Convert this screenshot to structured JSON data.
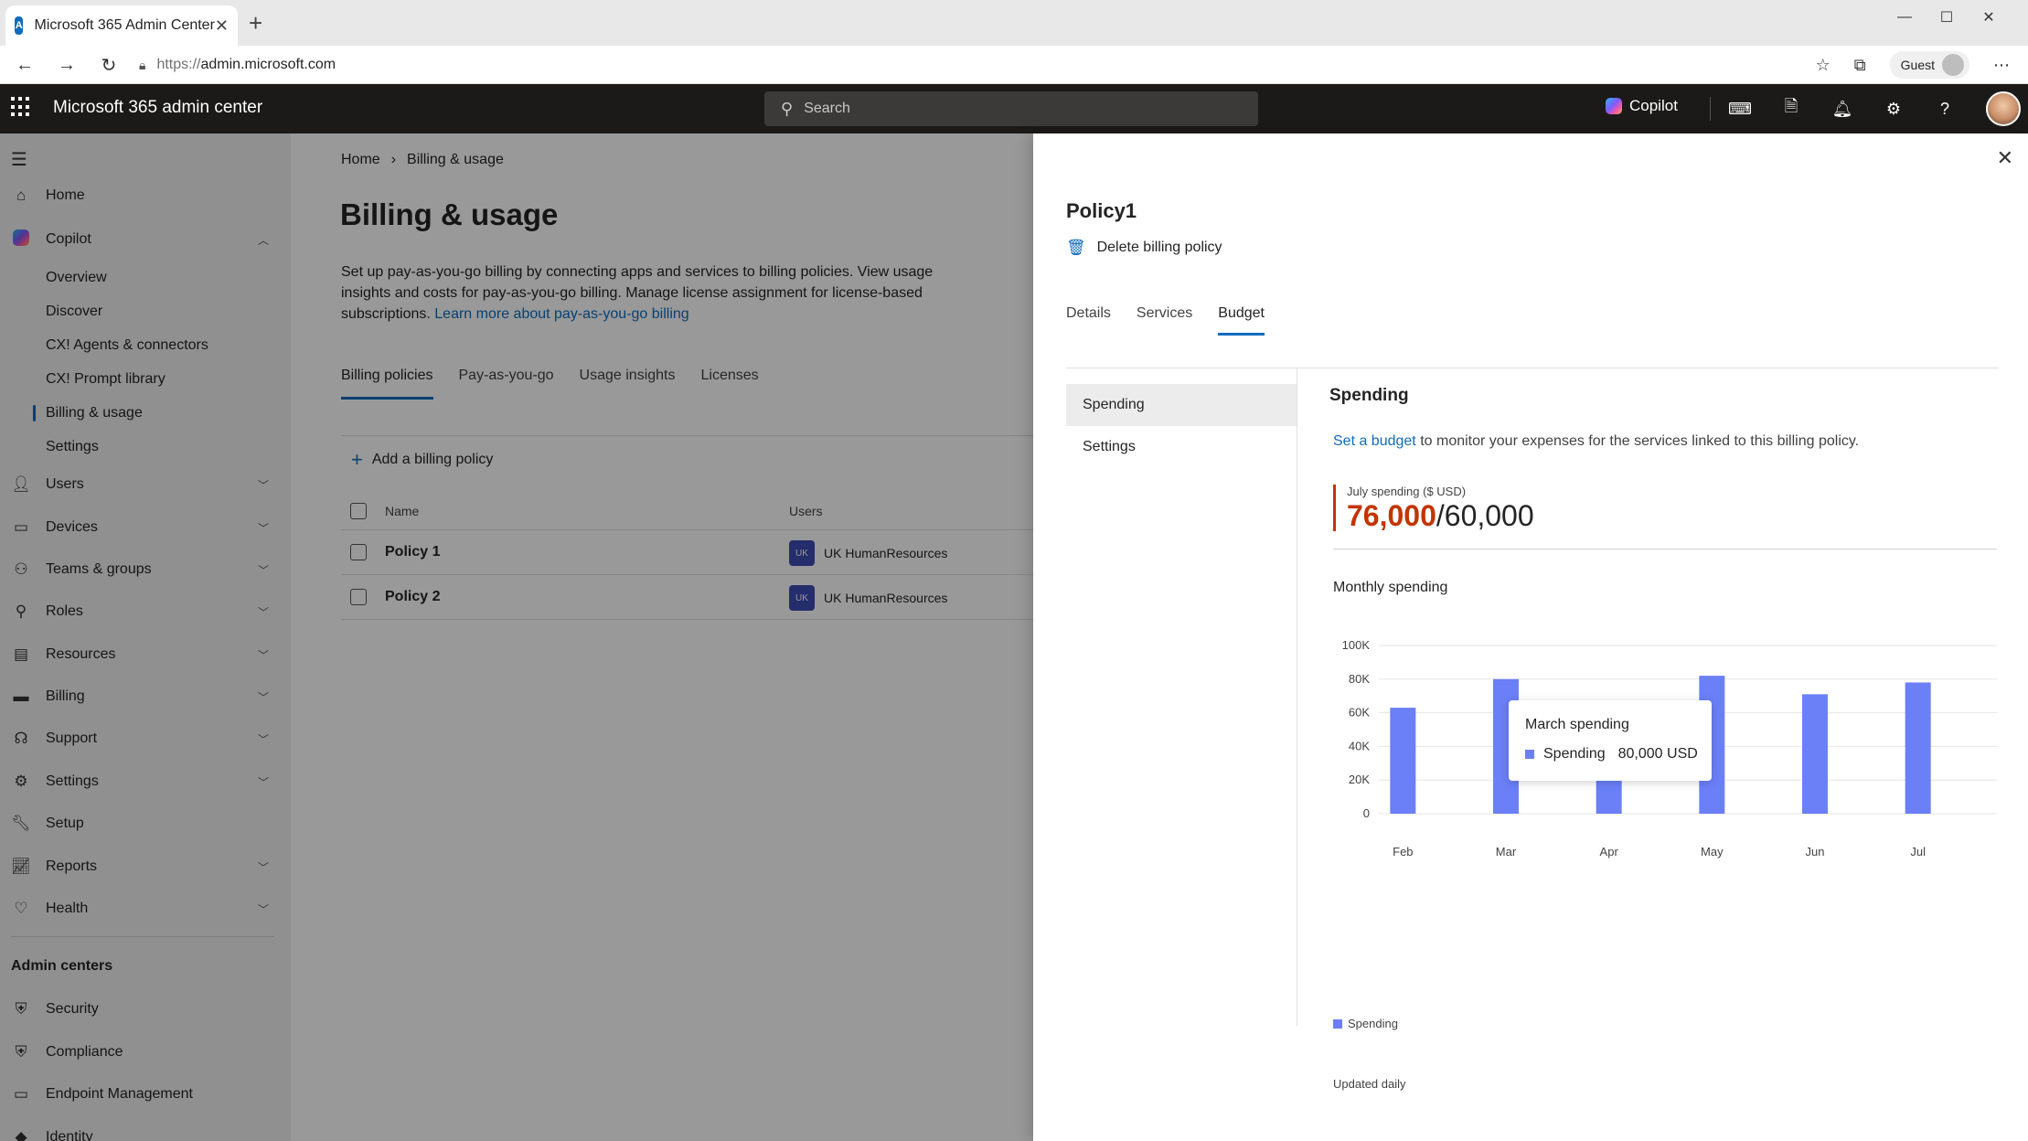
{
  "browser": {
    "tab_title": "Microsoft 365 Admin Center",
    "url_proto": "https://",
    "url_host": "admin.microsoft.com",
    "profile_label": "Guest"
  },
  "suite": {
    "title": "Microsoft 365 admin center",
    "search_placeholder": "Search",
    "copilot_label": "Copilot"
  },
  "leftnav": {
    "items": [
      {
        "label": "Home"
      },
      {
        "label": "Copilot"
      },
      {
        "label": "Users"
      },
      {
        "label": "Devices"
      },
      {
        "label": "Teams & groups"
      },
      {
        "label": "Roles"
      },
      {
        "label": "Resources"
      },
      {
        "label": "Billing"
      },
      {
        "label": "Support"
      },
      {
        "label": "Settings"
      },
      {
        "label": "Setup"
      },
      {
        "label": "Reports"
      },
      {
        "label": "Health"
      }
    ],
    "copilot_sub": [
      {
        "label": "Overview"
      },
      {
        "label": "Discover"
      },
      {
        "label": "CX! Agents & connectors"
      },
      {
        "label": "CX! Prompt library"
      },
      {
        "label": "Billing & usage"
      },
      {
        "label": "Settings"
      }
    ],
    "admin_centers_heading": "Admin centers",
    "admin_centers": [
      {
        "label": "Security"
      },
      {
        "label": "Compliance"
      },
      {
        "label": "Endpoint Management"
      },
      {
        "label": "Identity"
      }
    ]
  },
  "main": {
    "breadcrumb_home": "Home",
    "breadcrumb_current": "Billing & usage",
    "title": "Billing & usage",
    "desc": "Set up pay-as-you-go billing by connecting apps and services to billing policies. View usage insights and costs for pay-as-you-go billing. Manage license assignment for license-based subscriptions.",
    "desc_link": "Learn more about pay-as-you-go billing",
    "tabs": [
      "Billing policies",
      "Pay-as-you-go",
      "Usage insights",
      "Licenses"
    ],
    "add_policy": "Add a billing policy",
    "col_name": "Name",
    "col_users": "Users",
    "rows": [
      {
        "name": "Policy 1",
        "badge": "UK",
        "users": "UK HumanResources"
      },
      {
        "name": "Policy 2",
        "badge": "UK",
        "users": "UK HumanResources"
      }
    ]
  },
  "panel": {
    "title": "Policy1",
    "delete_label": "Delete billing policy",
    "tabs": [
      "Details",
      "Services",
      "Budget"
    ],
    "subnav": [
      "Spending",
      "Settings"
    ],
    "content_title": "Spending",
    "desc_link": "Set a budget",
    "desc_rest": " to monitor your expenses for the services linked to this billing policy.",
    "kpi_label": "July spending ($ USD)",
    "kpi_spent": "76,000",
    "kpi_budget": "/60,000",
    "chart_title": "Monthly spending",
    "legend_label": "Spending",
    "updated": "Updated daily",
    "tooltip_title": "March spending",
    "tooltip_series": "Spending",
    "tooltip_value": "80,000 USD"
  },
  "colors": {
    "accent": "#0f6cbd",
    "bar": "#6b7ff7",
    "over_budget": "#c33400"
  },
  "chart_data": {
    "type": "bar",
    "title": "Monthly spending",
    "categories": [
      "Feb",
      "Mar",
      "Apr",
      "May",
      "Jun",
      "Jul"
    ],
    "series": [
      {
        "name": "Spending",
        "values": [
          63000,
          80000,
          20000,
          82000,
          71000,
          78000
        ]
      }
    ],
    "yticks": [
      "0",
      "20K",
      "40K",
      "60K",
      "80K",
      "100K"
    ],
    "ylim": [
      0,
      100000
    ],
    "grid": true,
    "legend": "bottom-left"
  }
}
